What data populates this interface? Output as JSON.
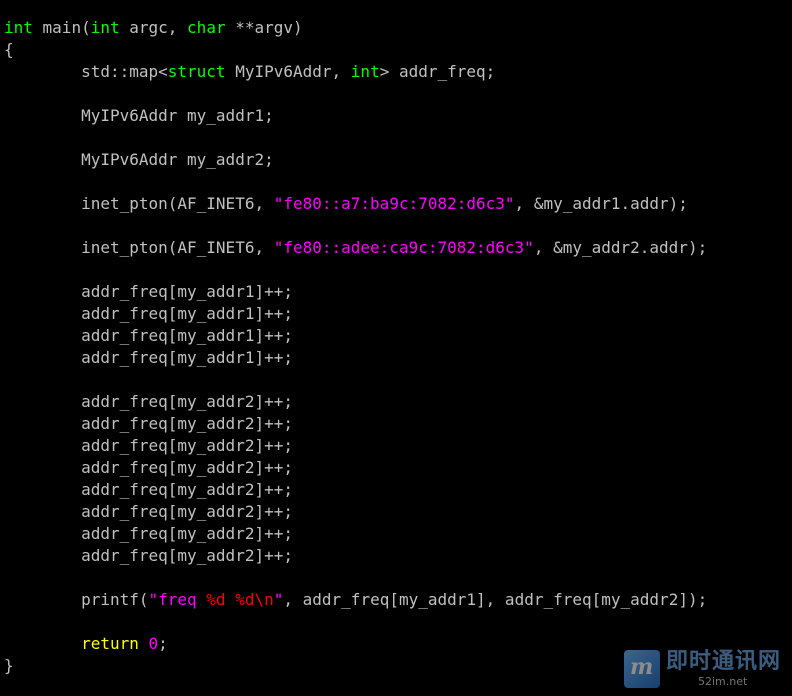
{
  "colors": {
    "background": "#000000",
    "text": "#c0c0c0",
    "keyword": "#ffff00",
    "type": "#00ff00",
    "string": "#ff00ff",
    "number": "#ff00ff",
    "format": "#ff0000"
  },
  "code": {
    "lines": [
      [
        {
          "t": "int",
          "c": "type"
        },
        {
          "t": " main(",
          "c": "text"
        },
        {
          "t": "int",
          "c": "type"
        },
        {
          "t": " argc, ",
          "c": "text"
        },
        {
          "t": "char",
          "c": "type"
        },
        {
          "t": " **argv)",
          "c": "text"
        }
      ],
      [
        {
          "t": "{",
          "c": "text"
        }
      ],
      [
        {
          "t": "        std::map<",
          "c": "text"
        },
        {
          "t": "struct",
          "c": "type"
        },
        {
          "t": " MyIPv6Addr, ",
          "c": "text"
        },
        {
          "t": "int",
          "c": "type"
        },
        {
          "t": "> addr_freq;",
          "c": "text"
        }
      ],
      [],
      [
        {
          "t": "        MyIPv6Addr my_addr1;",
          "c": "text"
        }
      ],
      [],
      [
        {
          "t": "        MyIPv6Addr my_addr2;",
          "c": "text"
        }
      ],
      [],
      [
        {
          "t": "        inet_pton(AF_INET6, ",
          "c": "text"
        },
        {
          "t": "\"fe80::a7:ba9c:7082:d6c3\"",
          "c": "string"
        },
        {
          "t": ", &my_addr1.addr);",
          "c": "text"
        }
      ],
      [],
      [
        {
          "t": "        inet_pton(AF_INET6, ",
          "c": "text"
        },
        {
          "t": "\"fe80::adee:ca9c:7082:d6c3\"",
          "c": "string"
        },
        {
          "t": ", &my_addr2.addr);",
          "c": "text"
        }
      ],
      [],
      [
        {
          "t": "        addr_freq[my_addr1]++;",
          "c": "text"
        }
      ],
      [
        {
          "t": "        addr_freq[my_addr1]++;",
          "c": "text"
        }
      ],
      [
        {
          "t": "        addr_freq[my_addr1]++;",
          "c": "text"
        }
      ],
      [
        {
          "t": "        addr_freq[my_addr1]++;",
          "c": "text"
        }
      ],
      [],
      [
        {
          "t": "        addr_freq[my_addr2]++;",
          "c": "text"
        }
      ],
      [
        {
          "t": "        addr_freq[my_addr2]++;",
          "c": "text"
        }
      ],
      [
        {
          "t": "        addr_freq[my_addr2]++;",
          "c": "text"
        }
      ],
      [
        {
          "t": "        addr_freq[my_addr2]++;",
          "c": "text"
        }
      ],
      [
        {
          "t": "        addr_freq[my_addr2]++;",
          "c": "text"
        }
      ],
      [
        {
          "t": "        addr_freq[my_addr2]++;",
          "c": "text"
        }
      ],
      [
        {
          "t": "        addr_freq[my_addr2]++;",
          "c": "text"
        }
      ],
      [
        {
          "t": "        addr_freq[my_addr2]++;",
          "c": "text"
        }
      ],
      [],
      [
        {
          "t": "        printf(",
          "c": "text"
        },
        {
          "t": "\"freq ",
          "c": "string"
        },
        {
          "t": "%d",
          "c": "format"
        },
        {
          "t": " ",
          "c": "string"
        },
        {
          "t": "%d",
          "c": "format"
        },
        {
          "t": "\\n",
          "c": "format"
        },
        {
          "t": "\"",
          "c": "string"
        },
        {
          "t": ", addr_freq[my_addr1], addr_freq[my_addr2]);",
          "c": "text"
        }
      ],
      [],
      [
        {
          "t": "        ",
          "c": "text"
        },
        {
          "t": "return",
          "c": "keyword"
        },
        {
          "t": " ",
          "c": "text"
        },
        {
          "t": "0",
          "c": "number"
        },
        {
          "t": ";",
          "c": "text"
        }
      ],
      [
        {
          "t": "}",
          "c": "text"
        }
      ]
    ]
  },
  "watermark": {
    "logo_glyph": "m",
    "title": "即时通讯网",
    "subtitle": "52im.net"
  }
}
